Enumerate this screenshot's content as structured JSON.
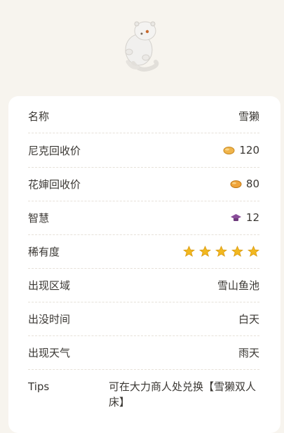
{
  "creature": {
    "image_name": "snow-otter-icon"
  },
  "rows": [
    {
      "label": "名称",
      "value": "雪獭"
    },
    {
      "label": "尼克回收价",
      "value": "120",
      "icon": "coin-icon"
    },
    {
      "label": "花婶回收价",
      "value": "80",
      "icon": "coin-icon"
    },
    {
      "label": "智慧",
      "value": "12",
      "icon": "graduation-cap-icon"
    },
    {
      "label": "稀有度",
      "stars": 5
    },
    {
      "label": "出现区域",
      "value": "雪山鱼池"
    },
    {
      "label": "出没时间",
      "value": "白天"
    },
    {
      "label": "出现天气",
      "value": "雨天"
    },
    {
      "label": "Tips",
      "value": "可在大力商人处兑换【雪獭双人床】"
    }
  ],
  "colors": {
    "background": "#f7f4ee",
    "card": "#ffffff",
    "coin": "#e9a235",
    "star": "#f2b81f",
    "cap": "#8a4d9a"
  }
}
